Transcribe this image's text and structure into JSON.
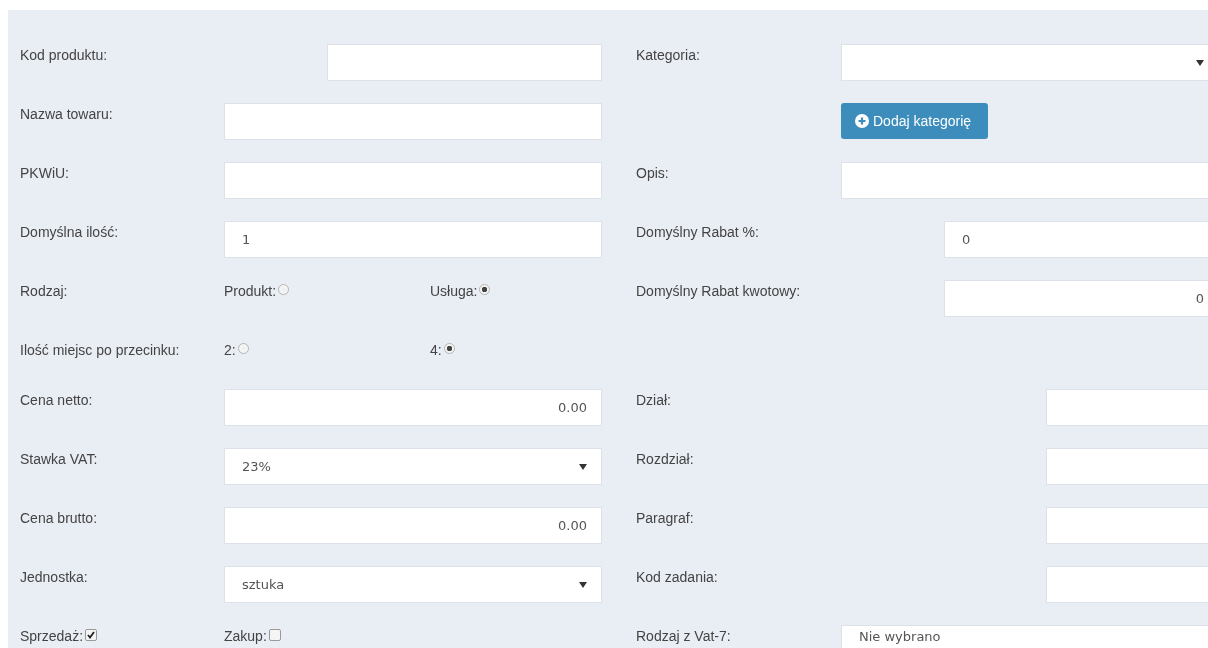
{
  "left": [
    {
      "kind": "text",
      "label": "Kod produktu:"
    },
    {
      "kind": "text",
      "label": "Nazwa towaru:"
    },
    {
      "kind": "text",
      "label": "PKWiU:"
    },
    {
      "kind": "text",
      "label": "Domyślna ilość:",
      "value": "1"
    },
    {
      "kind": "radio",
      "label": "Rodzaj:",
      "options": [
        {
          "label": "Produkt:",
          "selected": false
        },
        {
          "label": "Usługa:",
          "selected": true
        }
      ]
    },
    {
      "kind": "radio",
      "label": "Ilość miejsc po przecinku:",
      "options": [
        {
          "label": "2:",
          "selected": false
        },
        {
          "label": "4:",
          "selected": true
        }
      ]
    },
    {
      "kind": "number",
      "label": "Cena netto:",
      "value": "0.00"
    },
    {
      "kind": "select",
      "label": "Stawka VAT:",
      "value": "23%"
    },
    {
      "kind": "number",
      "label": "Cena brutto:",
      "value": "0.00"
    },
    {
      "kind": "select",
      "label": "Jednostka:",
      "value": "sztuka"
    },
    {
      "kind": "checks",
      "items": [
        {
          "label": "Sprzedaż:",
          "checked": true
        },
        {
          "label": "Zakup:",
          "checked": false
        }
      ]
    }
  ],
  "right": [
    {
      "kind": "select",
      "label": "Kategoria:"
    },
    {
      "kind": "button",
      "text": "Dodaj kategorię"
    },
    {
      "kind": "text",
      "label": "Opis:"
    },
    {
      "kind": "text",
      "label": "Domyślny Rabat %:",
      "value": "0"
    },
    {
      "kind": "number",
      "label": "Domyślny Rabat kwotowy:",
      "value": "0"
    },
    {
      "kind": "empty"
    },
    {
      "kind": "text",
      "label": "Dział:"
    },
    {
      "kind": "text",
      "label": "Rozdział:"
    },
    {
      "kind": "text",
      "label": "Paragraf:"
    },
    {
      "kind": "text",
      "label": "Kod zadania:"
    },
    {
      "kind": "select",
      "label": "Rodzaj z Vat-7:",
      "value": "Nie wybrano"
    }
  ]
}
